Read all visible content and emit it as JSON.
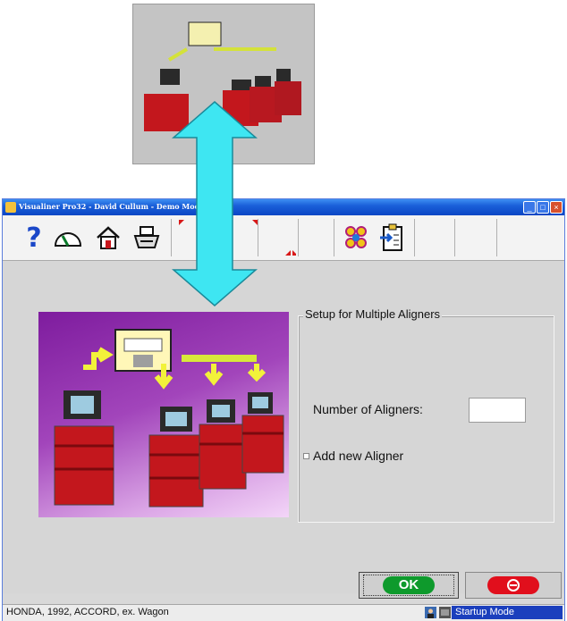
{
  "window": {
    "title": "Visualiner Pro32 - David Cullum - Demo Mode",
    "buttons": {
      "minimize": "_",
      "maximize": "□",
      "close": "×"
    }
  },
  "toolbar": {
    "help_icon": "?",
    "items": [
      "help-icon",
      "gauge-icon",
      "home-icon",
      "printer-icon",
      "multi-aligner-icon",
      "clipboard-icon"
    ]
  },
  "setup": {
    "title": "Setup for Multiple Aligners",
    "num_label": "Number of Aligners:",
    "num_value": "",
    "add_label": "Add new Aligner"
  },
  "actions": {
    "ok_label": "OK"
  },
  "statusbar": {
    "vehicle": "HONDA, 1992, ACCORD, ex. Wagon",
    "mode": "Startup Mode"
  },
  "colors": {
    "titlebar": "#0a46c4",
    "ok": "#0e9a2c",
    "cancel": "#e10f1c",
    "arrow": "#3ee6f2",
    "illustration": "#a245bb"
  }
}
